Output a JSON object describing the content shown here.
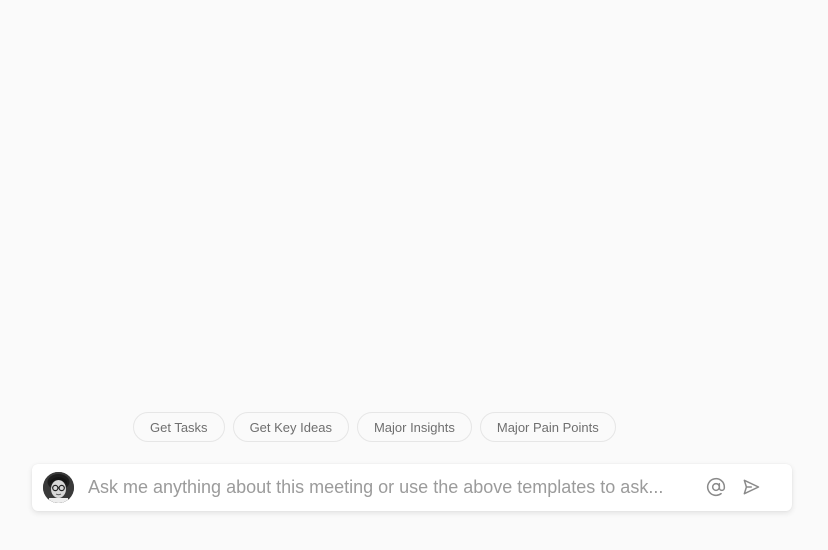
{
  "templates": [
    {
      "label": "Get Tasks"
    },
    {
      "label": "Get Key Ideas"
    },
    {
      "label": "Major Insights"
    },
    {
      "label": "Major Pain Points"
    }
  ],
  "chat": {
    "placeholder": "Ask me anything about this meeting or use the above templates to ask...",
    "value": "",
    "mention_icon": "at-sign-icon",
    "send_icon": "send-icon",
    "avatar": "user-avatar"
  },
  "colors": {
    "background": "#fafafa",
    "chip_border": "#e6e6e6",
    "chip_text": "#6f6f6f",
    "placeholder": "#9b9b9b",
    "icon": "#8a8a8a"
  }
}
